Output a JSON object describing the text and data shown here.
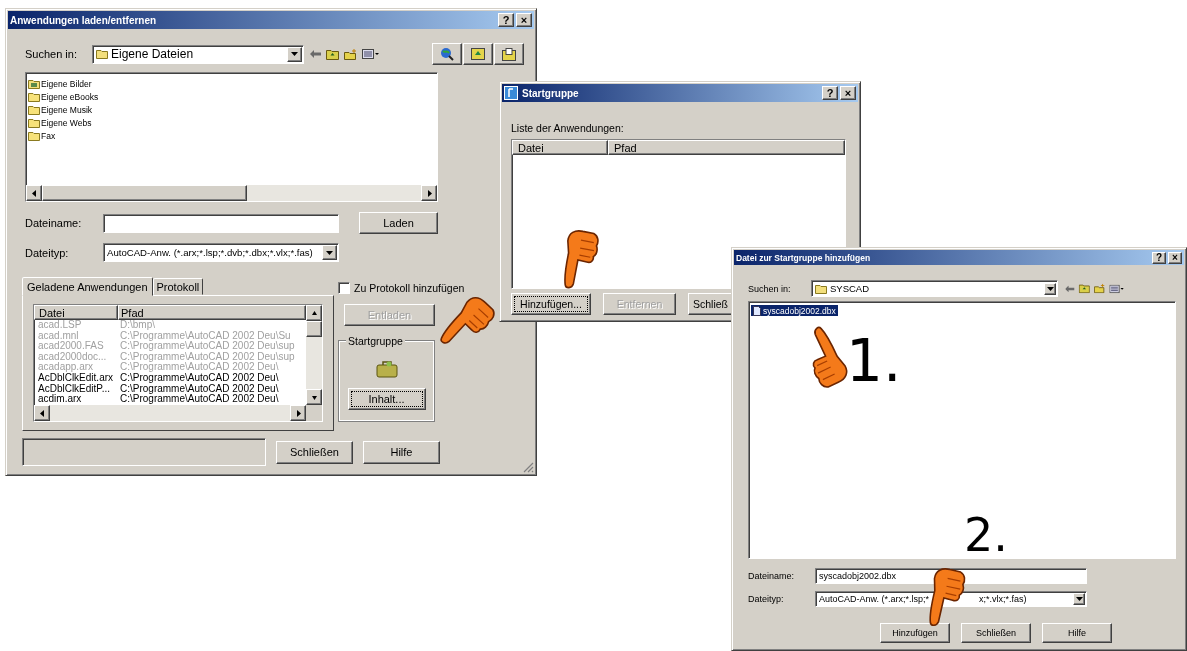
{
  "load_dialog": {
    "title": "Anwendungen laden/entfernen",
    "title_buttons": [
      "?",
      "×"
    ],
    "look_in_label": "Suchen in:",
    "look_in_value": "Eigene Dateien",
    "files": [
      {
        "name": "Eigene Bilder",
        "kind": "pictures"
      },
      {
        "name": "Eigene eBooks",
        "kind": "folder"
      },
      {
        "name": "Eigene Musik",
        "kind": "folder"
      },
      {
        "name": "Eigene Webs",
        "kind": "folder"
      },
      {
        "name": "Fax",
        "kind": "folder"
      }
    ],
    "filename_label": "Dateiname:",
    "load_button": "Laden",
    "filetype_label": "Dateityp:",
    "filetype_value": "AutoCAD-Anw. (*.arx;*.lsp;*.dvb;*.dbx;*.vlx;*.fas)",
    "tabs": [
      {
        "label": "Geladene Anwendungen",
        "selected": true
      },
      {
        "label": "Protokoll",
        "selected": false
      }
    ],
    "columns": [
      "Datei",
      "Pfad"
    ],
    "apps": [
      {
        "file": "acad.LSP",
        "path": "D:\\bmp\\",
        "greyed": true
      },
      {
        "file": "acad.mnl",
        "path": "C:\\Programme\\AutoCAD 2002 Deu\\Su",
        "greyed": true
      },
      {
        "file": "acad2000.FAS",
        "path": "C:\\Programme\\AutoCAD 2002 Deu\\sup",
        "greyed": true
      },
      {
        "file": "acad2000doc...",
        "path": "C:\\Programme\\AutoCAD 2002 Deu\\sup",
        "greyed": true
      },
      {
        "file": "acadapp.arx",
        "path": "C:\\Programme\\AutoCAD 2002 Deu\\",
        "greyed": true
      },
      {
        "file": "AcDblClkEdit.arx",
        "path": "C:\\Programme\\AutoCAD 2002 Deu\\",
        "greyed": false
      },
      {
        "file": "AcDblClkEditP...",
        "path": "C:\\Programme\\AutoCAD 2002 Deu\\",
        "greyed": false
      },
      {
        "file": "acdim.arx",
        "path": "C:\\Programme\\AutoCAD 2002 Deu\\",
        "greyed": false
      }
    ],
    "protocol_checkbox": {
      "label": "Zu Protokoll hinzufügen",
      "checked": false
    },
    "unload_button": {
      "label": "Entladen",
      "disabled": true
    },
    "startgroup": {
      "title": "Startgruppe",
      "contents_button": "Inhalt..."
    },
    "close_button": "Schließen",
    "help_button": "Hilfe"
  },
  "startgroup_dialog": {
    "title": "Startgruppe",
    "title_buttons": [
      "?",
      "×"
    ],
    "list_label": "Liste der Anwendungen:",
    "columns": [
      "Datei",
      "Pfad"
    ],
    "buttons": [
      {
        "label": "Hinzufügen...",
        "disabled": false
      },
      {
        "label": "Entfernen",
        "disabled": true
      },
      {
        "label": "Schließ",
        "disabled": false
      }
    ]
  },
  "add_dialog": {
    "title": "Datei zur Startgruppe hinzufügen",
    "title_buttons": [
      "?",
      "×"
    ],
    "look_in_label": "Suchen in:",
    "look_in_value": "SYSCAD",
    "files": [
      {
        "name": "syscadobj2002.dbx",
        "selected": true
      }
    ],
    "filename_label": "Dateiname:",
    "filename_value": "syscadobj2002.dbx",
    "filetype_label": "Dateityp:",
    "filetype_value_parts": [
      "AutoCAD-Anw. (*.arx;*.lsp;*",
      "x;*.vlx;*.fas)"
    ],
    "buttons": [
      "Hinzufügen",
      "Schließen",
      "Hilfe"
    ]
  },
  "step_labels": [
    "1.",
    "2."
  ]
}
